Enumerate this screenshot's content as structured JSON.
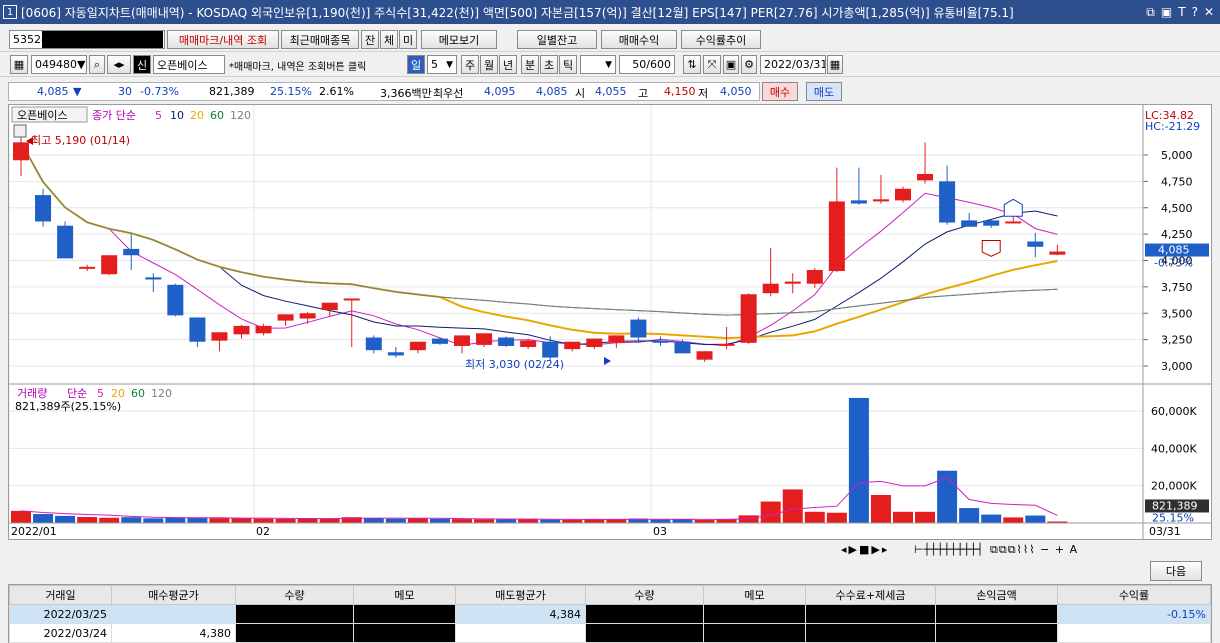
{
  "window": {
    "number": "1",
    "title": "[0606] 자동일지차트(매매내역) - KOSDAQ 외국인보유[1,190(천)] 주식수[31,422(천)] 액면[500] 자본금[157(억)] 결산[12월] EPS[147] PER[27.76] 시가총액[1,285(억)] 유통비율[75.1]",
    "controls": [
      "⧉",
      "▣",
      "T",
      "?",
      "✕"
    ]
  },
  "toolbar1": {
    "account": "5352-",
    "btn_mark": "매매마크/내역 조회",
    "btn_recent": "최근매매종목",
    "btn_jan": "잔",
    "btn_che": "체",
    "btn_mi": "미",
    "btn_memo": "메모보기",
    "btn_daily": "일별잔고",
    "btn_profit": "매매수익",
    "btn_trend": "수익률추이"
  },
  "toolbar2": {
    "code": "049480",
    "name": "오픈베이스",
    "hint": "*매매마크, 내역은 조회버튼 클릭",
    "period_sel": "일",
    "period_num": "5",
    "tabs": [
      "주",
      "월",
      "년",
      "분",
      "초",
      "틱"
    ],
    "count": "50/600",
    "date": "2022/03/31"
  },
  "quote": {
    "price": "4,085",
    "arrow": "▼",
    "change": "30",
    "rate": "-0.73%",
    "volume": "821,389",
    "vol_rate": "25.15%",
    "turn": "2.61%",
    "amount": "3,366백만",
    "best": "최우선",
    "bid": "4,095",
    "ask": "4,085",
    "open_lbl": "시",
    "open": "4,055",
    "high_lbl": "고",
    "high": "4,150",
    "low_lbl": "저",
    "low": "4,050",
    "buy": "매수",
    "sell": "매도"
  },
  "chart_data": {
    "type": "candlestick",
    "title": "오픈베이스",
    "ma_label": "종가 단순",
    "ma_periods": [
      "5",
      "10",
      "20",
      "60",
      "120"
    ],
    "ma_colors": [
      "#d020c0",
      "#0a1e6e",
      "#e8a800",
      "#108030",
      "#808080"
    ],
    "lc": "LC:34.82",
    "hc": "HC:-21.29",
    "max_label": "최고 5,190 (01/14)",
    "min_label": "최저 3,030 (02/24)",
    "price_ticks": [
      "5,000",
      "4,750",
      "4,500",
      "4,250",
      "4,000",
      "3,750",
      "3,500",
      "3,250",
      "3,000"
    ],
    "price_tick_values": [
      5000,
      4750,
      4500,
      4250,
      4000,
      3750,
      3500,
      3250,
      3000
    ],
    "cur_price": "4,085",
    "cur_rate": "-0.73%",
    "dates": [
      "2022/01",
      "02",
      "03",
      "03/31"
    ],
    "candles": [
      [
        4950,
        5190,
        4800,
        5120
      ],
      [
        4620,
        4680,
        4320,
        4370
      ],
      [
        4330,
        4370,
        4020,
        4020
      ],
      [
        3940,
        3960,
        3900,
        3940
      ],
      [
        3870,
        4020,
        3860,
        4050
      ],
      [
        4110,
        4250,
        3910,
        4050
      ],
      [
        3840,
        3880,
        3700,
        3820
      ],
      [
        3770,
        3780,
        3470,
        3480
      ],
      [
        3460,
        3460,
        3180,
        3230
      ],
      [
        3240,
        3280,
        3140,
        3320
      ],
      [
        3300,
        3390,
        3260,
        3380
      ],
      [
        3310,
        3400,
        3290,
        3380
      ],
      [
        3430,
        3460,
        3380,
        3490
      ],
      [
        3450,
        3510,
        3400,
        3500
      ],
      [
        3530,
        3570,
        3470,
        3600
      ],
      [
        3640,
        3640,
        3180,
        3640
      ],
      [
        3270,
        3290,
        3120,
        3150
      ],
      [
        3130,
        3180,
        3080,
        3100
      ],
      [
        3150,
        3210,
        3120,
        3230
      ],
      [
        3260,
        3270,
        3200,
        3210
      ],
      [
        3190,
        3290,
        3120,
        3290
      ],
      [
        3200,
        3270,
        3180,
        3310
      ],
      [
        3270,
        3280,
        3180,
        3190
      ],
      [
        3180,
        3260,
        3160,
        3240
      ],
      [
        3230,
        3280,
        3050,
        3080
      ],
      [
        3160,
        3210,
        3140,
        3230
      ],
      [
        3180,
        3260,
        3160,
        3260
      ],
      [
        3220,
        3270,
        3170,
        3290
      ],
      [
        3440,
        3460,
        3220,
        3270
      ],
      [
        3240,
        3280,
        3190,
        3220
      ],
      [
        3230,
        3250,
        3120,
        3120
      ],
      [
        3060,
        3140,
        3040,
        3140
      ],
      [
        3210,
        3370,
        3160,
        3210
      ],
      [
        3220,
        3690,
        3210,
        3680
      ],
      [
        3690,
        4120,
        3660,
        3780
      ],
      [
        3780,
        3880,
        3690,
        3800
      ],
      [
        3780,
        3930,
        3740,
        3910
      ],
      [
        3900,
        4880,
        3890,
        4560
      ],
      [
        4570,
        4880,
        4530,
        4540
      ],
      [
        4560,
        4810,
        4540,
        4580
      ],
      [
        4570,
        4700,
        4550,
        4680
      ],
      [
        4760,
        5120,
        4730,
        4820
      ],
      [
        4750,
        4900,
        4340,
        4360
      ],
      [
        4380,
        4450,
        4340,
        4320
      ],
      [
        4380,
        4390,
        4310,
        4330
      ],
      [
        4370,
        4460,
        4360,
        4370
      ],
      [
        4180,
        4260,
        4030,
        4130
      ],
      [
        4055,
        4150,
        4050,
        4085
      ]
    ],
    "vol_label": "거래량",
    "vol_ma_label": "단순",
    "vol_ma_periods": [
      "5",
      "20",
      "60",
      "120"
    ],
    "vol_cur": "821,389주(25.15%)",
    "vol_ticks": [
      "60,000K",
      "40,000K",
      "20,000K"
    ],
    "vol_tick_values": [
      60000,
      40000,
      20000
    ],
    "vol_cur_right": "821,389",
    "vol_cur_pct": "25.15%",
    "volumes": [
      6500,
      4800,
      3800,
      3200,
      2800,
      3100,
      2500,
      2800,
      2900,
      2600,
      2400,
      2300,
      2200,
      2600,
      2400,
      3100,
      2700,
      2300,
      2400,
      2200,
      2100,
      2000,
      1900,
      2200,
      1800,
      1700,
      2000,
      1900,
      2400,
      1800,
      1900,
      1600,
      2000,
      4100,
      11500,
      18000,
      6000,
      5500,
      67000,
      15000,
      6000,
      6000,
      28000,
      8000,
      4500,
      3000,
      4000,
      821
    ]
  },
  "bottom": {
    "next": "다음",
    "headers": [
      "거래일",
      "매수평균가",
      "수량",
      "메모",
      "매도평균가",
      "수량",
      "메모",
      "수수료+제세금",
      "손익금액",
      "수익률"
    ],
    "rows": [
      [
        "2022/03/25",
        "",
        "",
        "",
        "4,384",
        "",
        "",
        "",
        "",
        "-0.15%"
      ],
      [
        "2022/03/24",
        "4,380",
        "",
        "",
        "",
        "",
        "",
        "",
        "",
        ""
      ]
    ]
  }
}
